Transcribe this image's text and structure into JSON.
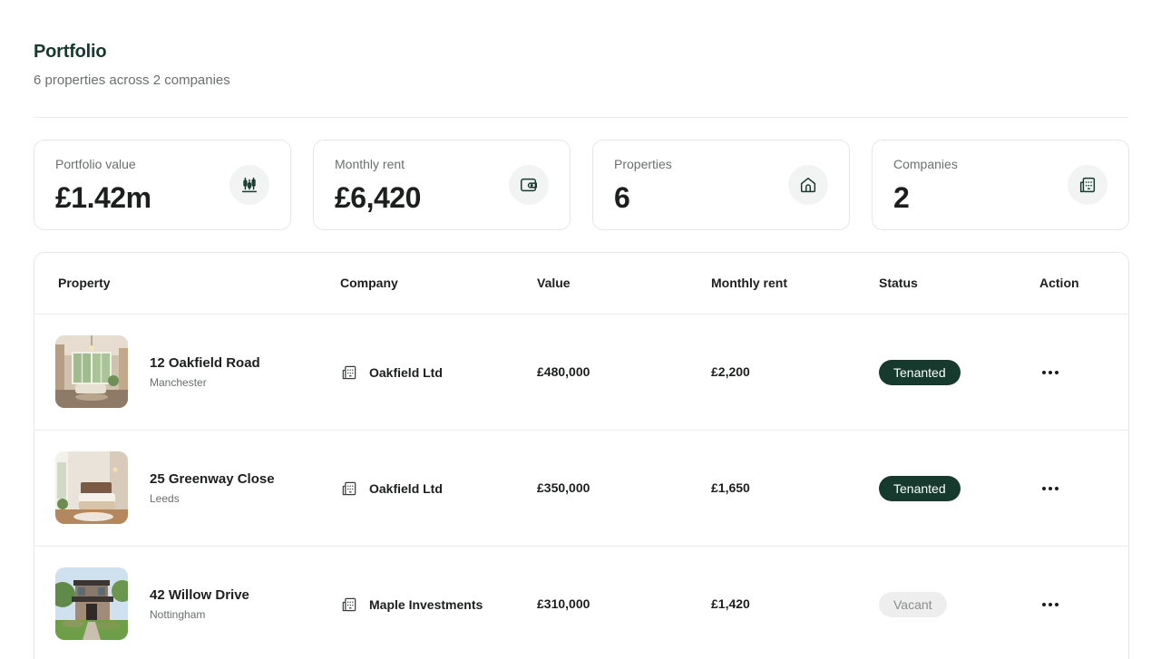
{
  "page": {
    "title": "Portfolio",
    "subtitle": "6 properties across 2 companies"
  },
  "stats": [
    {
      "label": "Portfolio value",
      "value": "£1.42m",
      "icon": "chart-icon"
    },
    {
      "label": "Monthly rent",
      "value": "£6,420",
      "icon": "wallet-icon"
    },
    {
      "label": "Properties",
      "value": "6",
      "icon": "home-icon"
    },
    {
      "label": "Companies",
      "value": "2",
      "icon": "building-icon"
    }
  ],
  "table": {
    "headers": {
      "property": "Property",
      "company": "Company",
      "value": "Value",
      "rent": "Monthly rent",
      "status": "Status",
      "action": "Action"
    },
    "rows": [
      {
        "name": "12 Oakfield Road",
        "city": "Manchester",
        "company": "Oakfield Ltd",
        "value": "£480,000",
        "rent": "£2,200",
        "status": "Tenanted"
      },
      {
        "name": "25 Greenway Close",
        "city": "Leeds",
        "company": "Oakfield Ltd",
        "value": "£350,000",
        "rent": "£1,650",
        "status": "Tenanted"
      },
      {
        "name": "42 Willow Drive",
        "city": "Nottingham",
        "company": "Maple Investments",
        "value": "£310,000",
        "rent": "£1,420",
        "status": "Vacant"
      }
    ]
  },
  "colors": {
    "brand": "#173a2e",
    "tenanted_bg": "#173a2e",
    "vacant_bg": "#eeeeee"
  }
}
